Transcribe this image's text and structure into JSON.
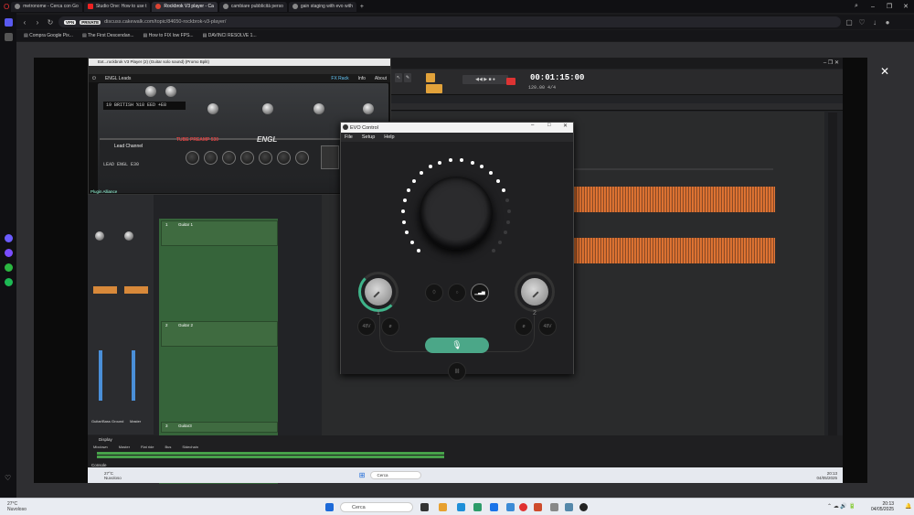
{
  "browser": {
    "tabs": [
      {
        "label": "metronome - Cerca con Go",
        "active": false
      },
      {
        "label": "Studio One: How to use t",
        "active": false
      },
      {
        "label": "Rockbrok V3 player - Ca",
        "active": true
      },
      {
        "label": "cambiare pubblicità perso",
        "active": false
      },
      {
        "label": "gain staging with evo with",
        "active": false
      }
    ],
    "url": "discuss.cakewalk.com/topic/84650-rockbrok-v3-player/",
    "vpn_label": "VPN",
    "vpn_state": "PRIVATE",
    "bookmarks": [
      "Compra Google Pix...",
      "The First Descendan...",
      "How to FIX low FPS...",
      "DAVINCI RESOLVE 1..."
    ]
  },
  "plugin": {
    "title": "Ext...rockbrok V3 Player (2) (Guitar solo sound) (Promo Bplit)",
    "preset": "ENGL Leads",
    "fx_rack": "FX Rack",
    "info": "Info",
    "about": "About",
    "lcd": "19 BRITISH %18 EED +E8",
    "channel": "Lead Channel",
    "amp_name": "TUBE PREAMP 530",
    "brand": "ENGL",
    "model": "LEAD ENGL E30",
    "footer": "Plugin Alliance"
  },
  "daw": {
    "timecode": "00:01:15:00",
    "tempo": "120.00",
    "signature": "4/4",
    "tracks": [
      {
        "num": "1",
        "name": "Guitar 1"
      },
      {
        "num": "2",
        "name": "Guitar 2"
      },
      {
        "num": "3",
        "name": "Guitar3"
      }
    ],
    "mixer_labels": [
      "Guitar/Bass Ground",
      "Master"
    ],
    "bottom_tabs": [
      "Mixdown",
      "Master",
      "Flat ride",
      "Bus",
      "Sidechain"
    ],
    "console_label": "Console",
    "display_label": "Display"
  },
  "evo": {
    "title": "EVO Control",
    "menu": [
      "File",
      "Setup",
      "Help"
    ],
    "channel1": "1",
    "channel2": "2",
    "gain_level_fraction": 0.75
  },
  "inner_taskbar": {
    "weather_temp": "27°C",
    "weather_desc": "Nuvoloso",
    "search": "Cerca",
    "time": "20:13",
    "date": "04/05/2025"
  },
  "taskbar": {
    "weather_temp": "27°C",
    "weather_desc": "Nuvoloso",
    "search": "Cerca",
    "time": "20:13",
    "date": "04/05/2025"
  }
}
